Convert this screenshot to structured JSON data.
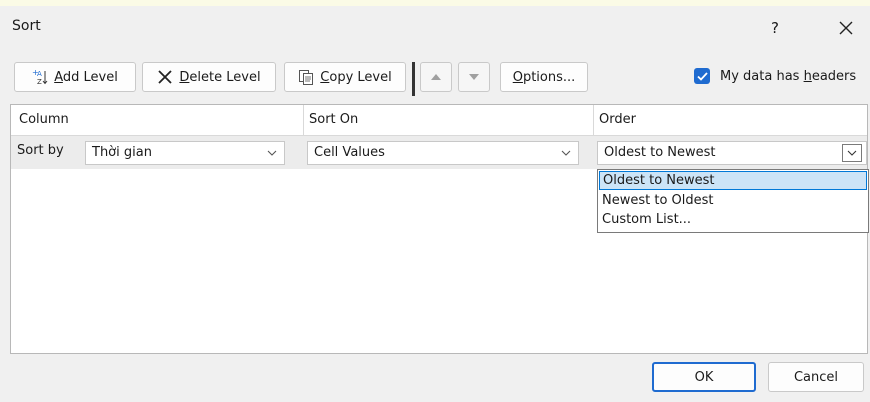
{
  "window": {
    "title": "Sort",
    "help_label": "?"
  },
  "toolbar": {
    "add_level": {
      "prefix": "",
      "key": "A",
      "rest": "dd Level"
    },
    "delete_level": {
      "key": "D",
      "rest": "elete Level"
    },
    "copy_level": {
      "key": "C",
      "rest": "opy Level"
    },
    "options": {
      "key": "O",
      "rest": "ptions..."
    },
    "my_data_headers": {
      "text": "My data has ",
      "key": "h",
      "rest": "eaders",
      "checked": true
    }
  },
  "grid": {
    "headers": {
      "column": "Column",
      "sort_on": "Sort On",
      "order": "Order"
    },
    "row": {
      "label": "Sort by",
      "column_value": "Thời gian",
      "sort_on_value": "Cell Values",
      "order_value": "Oldest to Newest"
    },
    "order_options": [
      "Oldest to Newest",
      "Newest to Oldest",
      "Custom List..."
    ],
    "selected_option_index": 0
  },
  "footer": {
    "ok": "OK",
    "cancel": "Cancel"
  },
  "colors": {
    "accent": "#1f6bd0",
    "selection_bg": "#cce4f7",
    "selection_border": "#0078d7"
  }
}
